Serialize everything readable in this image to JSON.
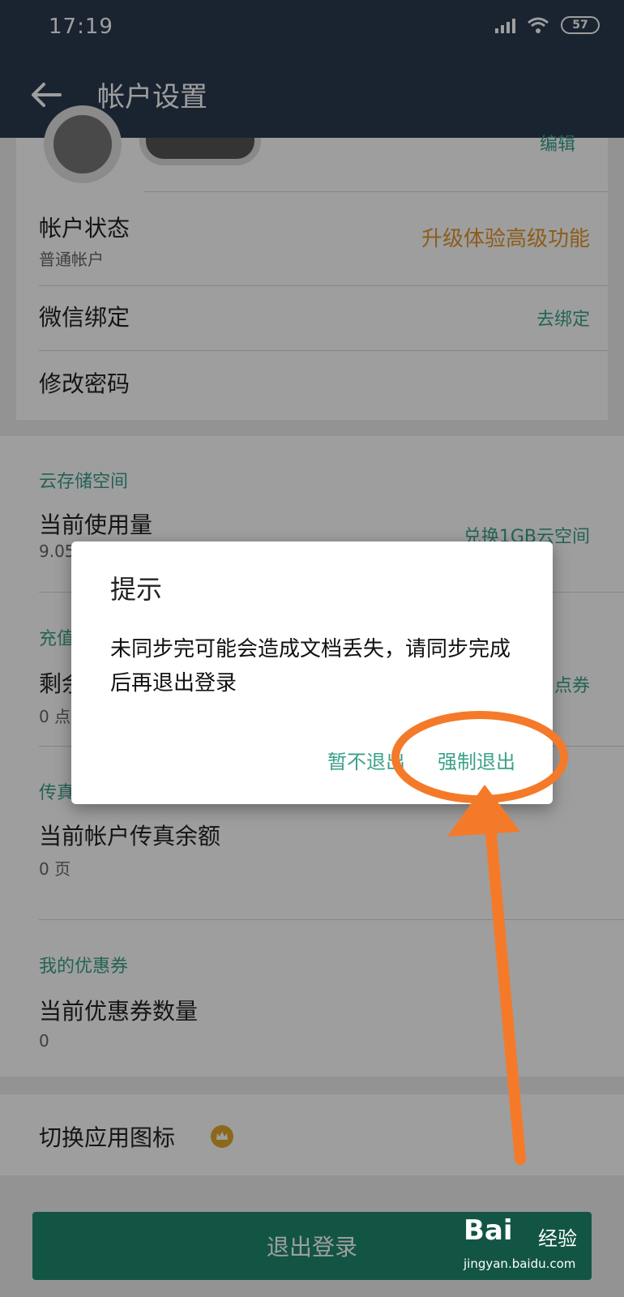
{
  "status_bar": {
    "time": "17:19",
    "battery": "57"
  },
  "app_bar": {
    "title": "帐户设置"
  },
  "account": {
    "edit_label": "编辑",
    "status_title": "帐户状态",
    "status_value": "普通帐户",
    "upgrade_label": "升级体验高级功能",
    "wechat_title": "微信绑定",
    "unbind_label": "去绑定",
    "password_title": "修改密码"
  },
  "cloud": {
    "section": "云存储空间",
    "usage_title": "当前使用量",
    "usage_value": "9.05",
    "action": "兑换1GB云空间"
  },
  "recharge": {
    "section": "充值",
    "remaining_title": "剩余",
    "remaining_value": "0 点",
    "action": "点券"
  },
  "fax": {
    "section": "传真",
    "balance_title": "当前帐户传真余额",
    "balance_value": "0 页"
  },
  "coupons": {
    "section": "我的优惠券",
    "count_title": "当前优惠券数量",
    "count_value": "0"
  },
  "switch_icon": {
    "label": "切换应用图标"
  },
  "logout": {
    "label": "退出登录"
  },
  "dialog": {
    "title": "提示",
    "message": "未同步完可能会造成文档丢失，请同步完成后再退出登录",
    "cancel_label": "暂不退出",
    "confirm_label": "强制退出"
  },
  "watermark": {
    "logo": "Bai",
    "name": "经验",
    "url": "jingyan.baidu.com"
  },
  "colors": {
    "header": "#2b3a4f",
    "accent": "#3aa08a",
    "upgrade": "#e3962c",
    "logout": "#1f8a6f",
    "annotation": "#f47a2a"
  }
}
